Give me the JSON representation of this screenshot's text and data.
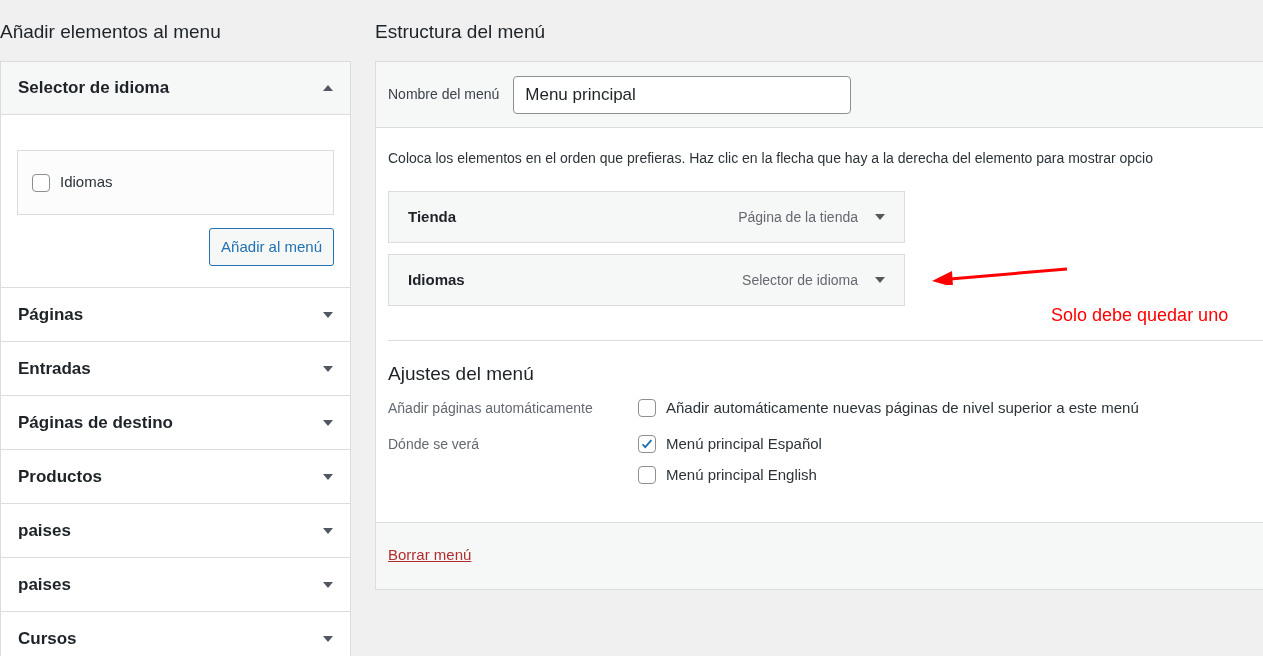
{
  "add_items": {
    "title": "Añadir elementos al menu",
    "sections": [
      {
        "label": "Selector de idioma",
        "expanded": true,
        "items": [
          {
            "label": "Idiomas",
            "checked": false
          }
        ],
        "button": "Añadir al menú"
      },
      {
        "label": "Páginas",
        "expanded": false
      },
      {
        "label": "Entradas",
        "expanded": false
      },
      {
        "label": "Páginas de destino",
        "expanded": false
      },
      {
        "label": "Productos",
        "expanded": false
      },
      {
        "label": "paises",
        "expanded": false
      },
      {
        "label": "paises",
        "expanded": false
      },
      {
        "label": "Cursos",
        "expanded": false
      }
    ]
  },
  "structure": {
    "title": "Estructura del menú",
    "name_label": "Nombre del menú",
    "name_value": "Menu principal",
    "instructions": "Coloca los elementos en el orden que prefieras. Haz clic en la flecha que hay a la derecha del elemento para mostrar opcio",
    "menu_items": [
      {
        "title": "Tienda",
        "type": "Página de la tienda"
      },
      {
        "title": "Idiomas",
        "type": "Selector de idioma"
      }
    ],
    "settings": {
      "title": "Ajustes del menú",
      "rows": [
        {
          "label": "Añadir páginas automáticamente",
          "options": [
            {
              "label": "Añadir automáticamente nuevas páginas de nivel superior a este menú",
              "checked": false
            }
          ]
        },
        {
          "label": "Dónde se verá",
          "options": [
            {
              "label": "Menú principal Español",
              "checked": true
            },
            {
              "label": "Menú principal English",
              "checked": false
            }
          ]
        }
      ]
    },
    "delete_link": "Borrar menú"
  },
  "annotation": {
    "text": "Solo debe quedar uno"
  }
}
